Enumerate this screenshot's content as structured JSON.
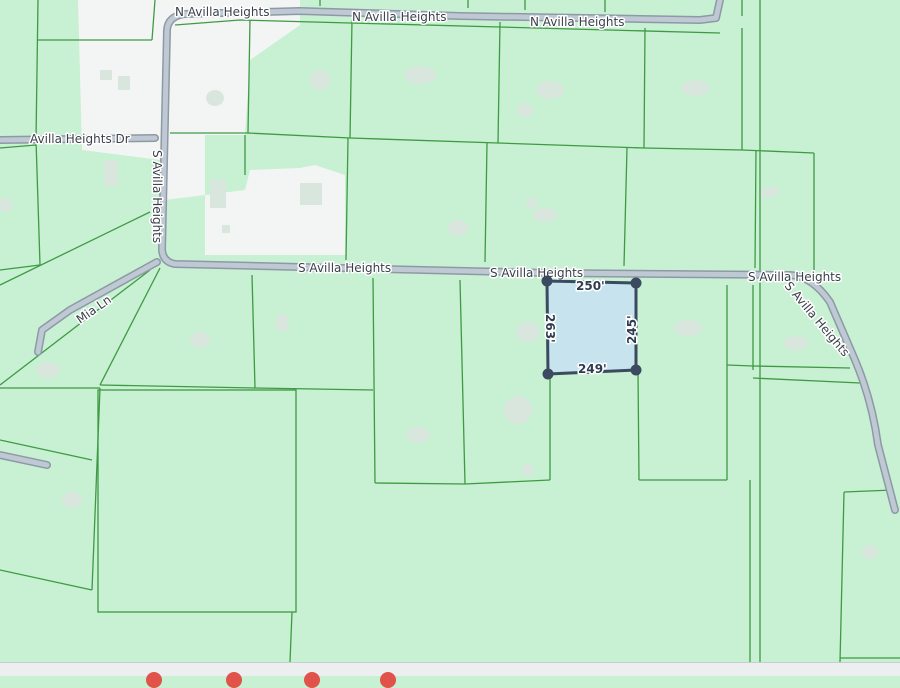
{
  "map": {
    "colors": {
      "land": "#c8f0d2",
      "clearing": "#f3f5f4",
      "parcel_line": "#3f9a44",
      "road_fill": "#bfc9d3",
      "road_outline": "#8e99a6",
      "selection_fill": "#c6e3ee",
      "selection_outline": "#3b4a60",
      "control_dot": "#e0524a"
    },
    "streets": {
      "n_avilla_1": "N Avilla Heights",
      "n_avilla_2": "N Avilla Heights",
      "n_avilla_3": "N Avilla Heights",
      "avilla_heights_dr": "Avilla Heights Dr",
      "s_avilla_vertical": "S Avilla Heights",
      "mia_ln": "Mia Ln",
      "s_avilla_1": "S Avilla Heights",
      "s_avilla_2": "S Avilla Heights",
      "s_avilla_3": "S Avilla Heights"
    },
    "selected_parcel": {
      "dims": {
        "top": "250'",
        "right": "245'",
        "bottom": "249'",
        "left": "263'"
      }
    }
  }
}
